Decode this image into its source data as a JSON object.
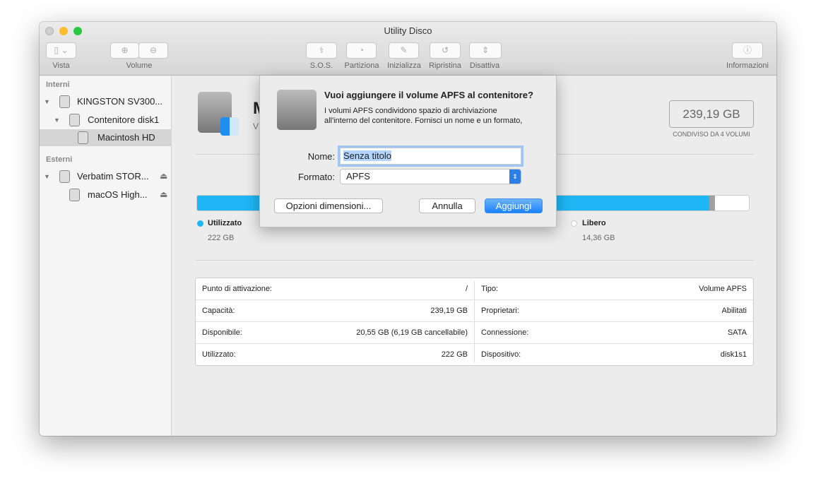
{
  "window": {
    "title": "Utility Disco"
  },
  "toolbar": {
    "vista": "Vista",
    "volume": "Volume",
    "sos": "S.O.S.",
    "partiziona": "Partiziona",
    "inizializza": "Inizializza",
    "ripristina": "Ripristina",
    "disattiva": "Disattiva",
    "informazioni": "Informazioni"
  },
  "sidebar": {
    "interni": "Interni",
    "esterni": "Esterni",
    "items": [
      {
        "label": "KINGSTON SV300..."
      },
      {
        "label": "Contenitore disk1"
      },
      {
        "label": "Macintosh HD"
      },
      {
        "label": "Verbatim STOR..."
      },
      {
        "label": "macOS High..."
      }
    ]
  },
  "volume": {
    "title_partial": "M",
    "subtitle_partial": "V",
    "capacity": "239,19 GB",
    "shared": "CONDIVISO DA 4 VOLUMI",
    "used_fraction": 0.928,
    "colors": {
      "used": "#1eb6f5",
      "other": "#a0a0a0",
      "free": "#ffffff"
    }
  },
  "legend": {
    "used_label": "Utilizzato",
    "used_value": "222 GB",
    "free_label": "Libero",
    "free_value": "14,36 GB"
  },
  "info": {
    "left": [
      {
        "k": "Punto di attivazione:",
        "v": "/"
      },
      {
        "k": "Capacità:",
        "v": "239,19 GB"
      },
      {
        "k": "Disponibile:",
        "v": "20,55 GB (6,19 GB cancellabile)"
      },
      {
        "k": "Utilizzato:",
        "v": "222 GB"
      }
    ],
    "right": [
      {
        "k": "Tipo:",
        "v": "Volume APFS"
      },
      {
        "k": "Proprietari:",
        "v": "Abilitati"
      },
      {
        "k": "Connessione:",
        "v": "SATA"
      },
      {
        "k": "Dispositivo:",
        "v": "disk1s1"
      }
    ]
  },
  "dialog": {
    "heading": "Vuoi aggiungere il volume APFS al contenitore?",
    "body1": "I volumi APFS condividono spazio di archiviazione",
    "body2": "all'interno del contenitore. Fornisci un nome e un formato,",
    "name_label": "Nome:",
    "name_value": "Senza titolo",
    "format_label": "Formato:",
    "format_value": "APFS",
    "size_options": "Opzioni dimensioni...",
    "cancel": "Annulla",
    "add": "Aggiungi"
  }
}
